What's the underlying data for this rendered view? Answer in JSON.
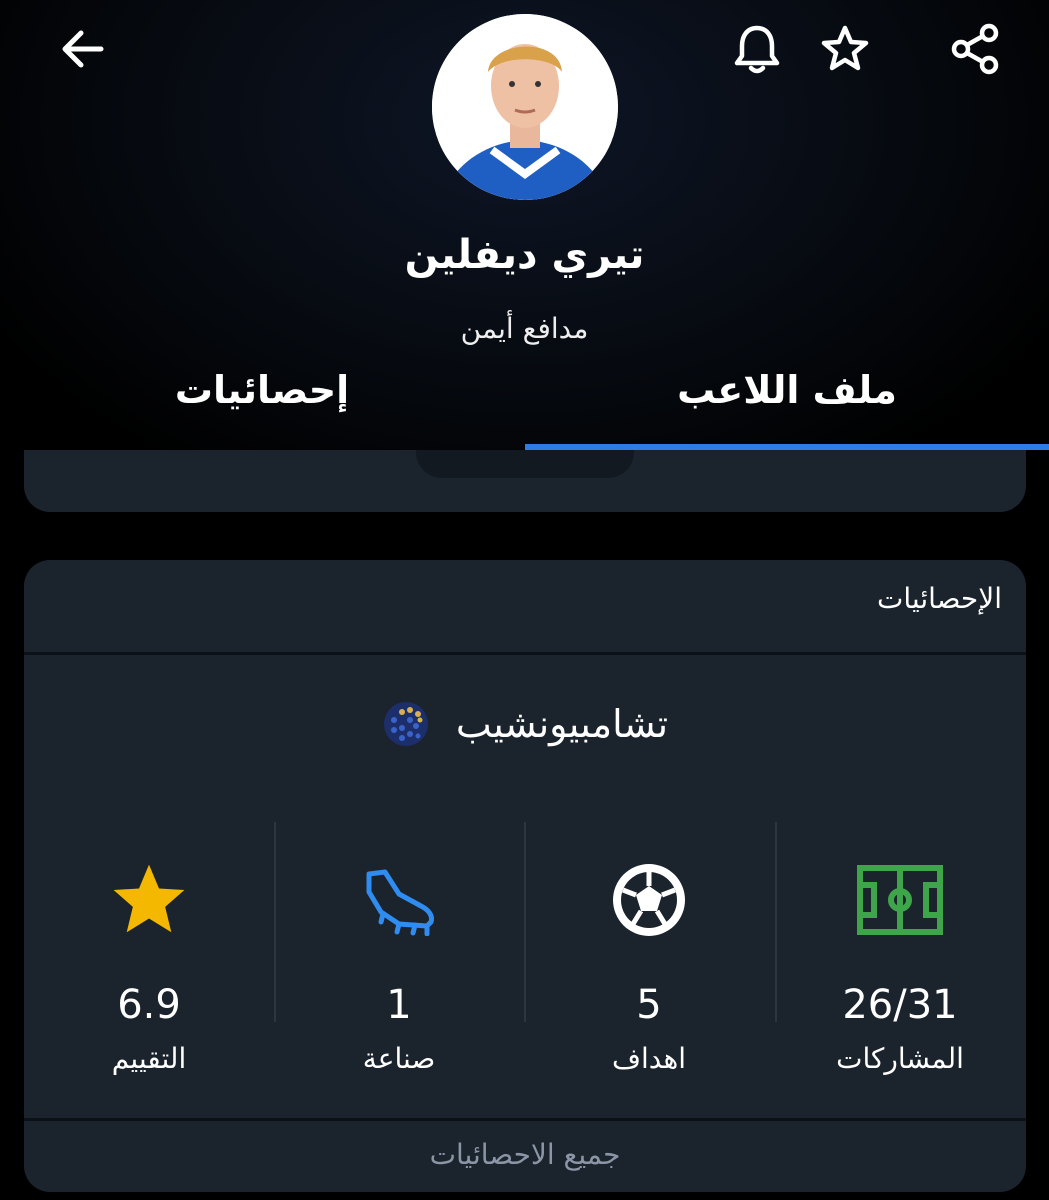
{
  "player": {
    "name": "تيري ديفلين",
    "position": "مدافع أيمن"
  },
  "tabs": [
    {
      "label": "ملف اللاعب",
      "active": true
    },
    {
      "label": "إحصائيات",
      "active": false
    }
  ],
  "icons": {
    "back": "arrow-left-icon",
    "bell": "bell-icon",
    "favorite": "star-outline-icon",
    "share": "share-icon"
  },
  "stats": {
    "title": "الإحصائيات",
    "competition": "تشامبيونشيب",
    "items": [
      {
        "value": "26/31",
        "label": "المشاركات",
        "icon": "pitch-icon",
        "color": "#3fa54a"
      },
      {
        "value": "5",
        "label": "اهداف",
        "icon": "football-icon",
        "color": "#ffffff"
      },
      {
        "value": "1",
        "label": "صناعة",
        "icon": "boot-icon",
        "color": "#2f8cf0"
      },
      {
        "value": "6.9",
        "label": "التقييم",
        "icon": "star-icon",
        "color": "#f5b800"
      }
    ],
    "all_link": "جميع الاحصائيات"
  },
  "colors": {
    "accent": "#2e7de6",
    "card": "#1b232d",
    "background": "#000000"
  }
}
